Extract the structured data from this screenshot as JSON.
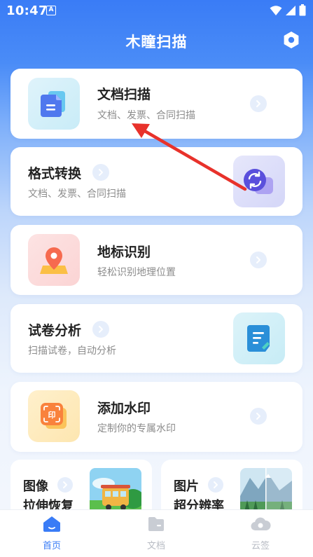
{
  "status": {
    "time": "10:47",
    "notice": "A"
  },
  "header": {
    "title": "木瞳扫描"
  },
  "cards": [
    {
      "title": "文档扫描",
      "subtitle": "文档、发票、合同扫描"
    },
    {
      "title": "格式转换",
      "subtitle": "文档、发票、合同扫描"
    },
    {
      "title": "地标识别",
      "subtitle": "轻松识别地理位置"
    },
    {
      "title": "试卷分析",
      "subtitle": "扫描试卷，自动分析"
    },
    {
      "title": "添加水印",
      "subtitle": "定制你的专属水印"
    }
  ],
  "half_cards": [
    {
      "line1": "图像",
      "line2": "拉伸恢复"
    },
    {
      "line1": "图片",
      "line2": "超分辨率"
    }
  ],
  "nav": [
    {
      "label": "首页",
      "active": true
    },
    {
      "label": "文档",
      "active": false
    },
    {
      "label": "云签",
      "active": false
    }
  ],
  "colors": {
    "primary": "#3a7cf6",
    "annotation_arrow": "#e8322b",
    "inactive": "#c2c6cd"
  }
}
